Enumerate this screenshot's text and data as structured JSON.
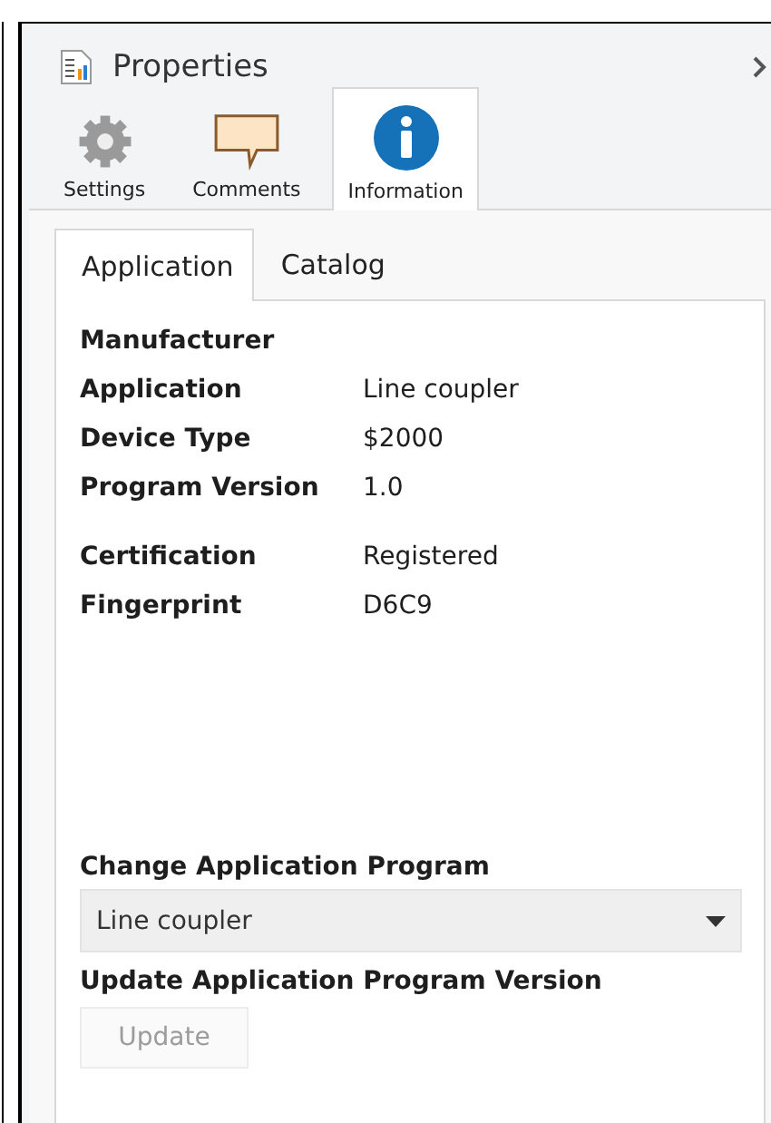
{
  "panel": {
    "title": "Properties"
  },
  "icon_tabs": [
    {
      "label": "Settings",
      "kind": "gear",
      "selected": false
    },
    {
      "label": "Comments",
      "kind": "comment",
      "selected": false
    },
    {
      "label": "Information",
      "kind": "info",
      "selected": true
    }
  ],
  "sub_tabs": [
    {
      "label": "Application",
      "selected": true
    },
    {
      "label": "Catalog",
      "selected": false
    }
  ],
  "info_groups": [
    [
      {
        "label": "Manufacturer"
      },
      {
        "label": "Application",
        "value": "Line coupler"
      },
      {
        "label": "Device Type",
        "value": "$2000"
      },
      {
        "label": "Program Version",
        "value": "1.0"
      }
    ],
    [
      {
        "label": "Certification",
        "value": "Registered"
      },
      {
        "label": "Fingerprint",
        "value": "D6C9"
      }
    ]
  ],
  "change_program": {
    "heading": "Change Application Program",
    "value": "Line coupler"
  },
  "update_version": {
    "heading": "Update Application Program Version",
    "button": {
      "label": "Update",
      "disabled": true
    }
  }
}
